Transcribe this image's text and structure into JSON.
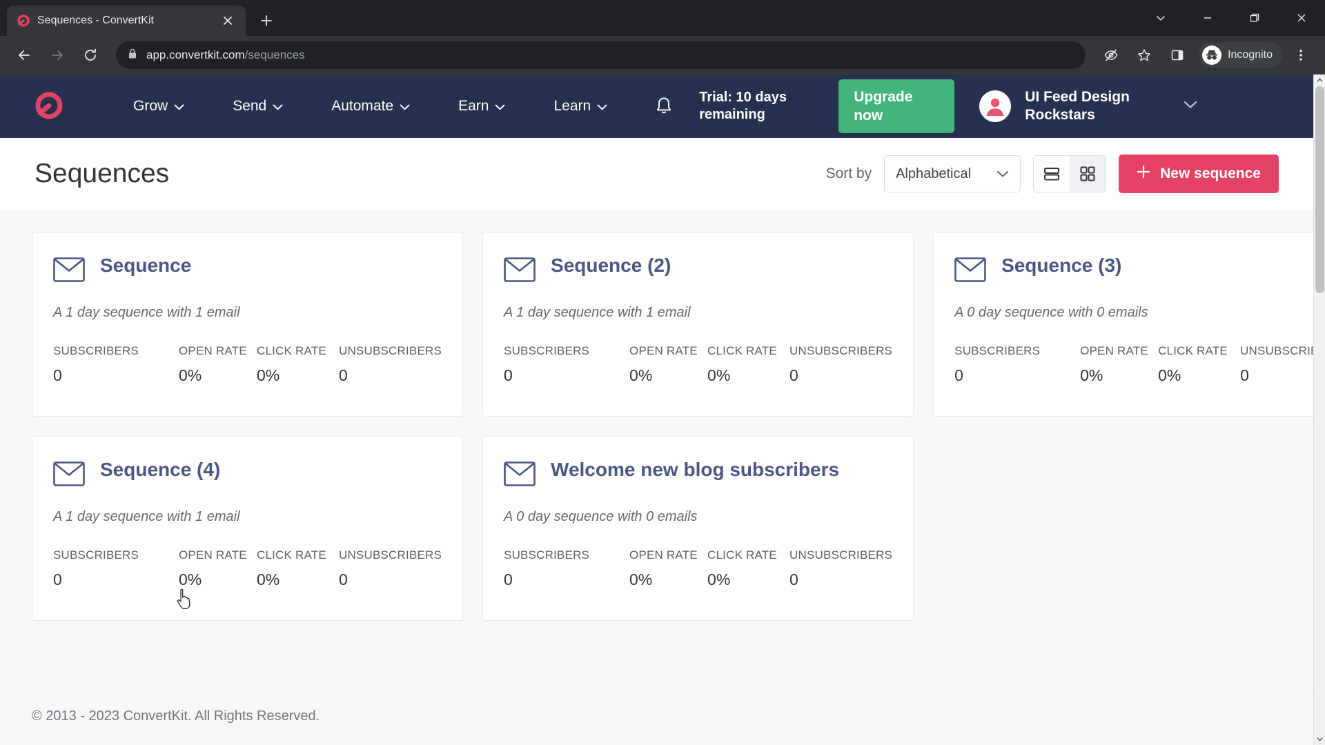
{
  "browser": {
    "tab": {
      "title": "Sequences - ConvertKit",
      "favicon_icon": "convertkit-logo-icon",
      "close_icon": "close-icon"
    },
    "new_tab_icon": "plus-icon",
    "window_controls": [
      {
        "name": "tab-search",
        "glyph": "⌄"
      },
      {
        "name": "minimize",
        "glyph": "—"
      },
      {
        "name": "maximize",
        "glyph": "❐"
      },
      {
        "name": "close",
        "glyph": "✕"
      }
    ],
    "nav": {
      "back_icon": "back-arrow-icon",
      "forward_icon": "forward-arrow-icon",
      "reload_icon": "reload-icon"
    },
    "omnibox": {
      "lock_icon": "lock-icon",
      "url_host": "app.convertkit.com",
      "url_path": "/sequences",
      "cookies_icon": "eye-slash-icon",
      "bookmark_icon": "star-icon",
      "side_panel_icon": "side-panel-icon"
    },
    "incognito": {
      "label": "Incognito",
      "icon": "incognito-icon"
    },
    "menu_icon": "kebab-menu-icon"
  },
  "appnav": {
    "logo_icon": "convertkit-logo-icon",
    "links": [
      {
        "label": "Grow",
        "icon": "chevron-down-icon"
      },
      {
        "label": "Send",
        "icon": "chevron-down-icon"
      },
      {
        "label": "Automate",
        "icon": "chevron-down-icon"
      },
      {
        "label": "Earn",
        "icon": "chevron-down-icon"
      },
      {
        "label": "Learn",
        "icon": "chevron-down-icon"
      }
    ],
    "notifications_icon": "bell-icon",
    "trial_text": "Trial: 10 days remaining",
    "upgrade_label": "Upgrade now",
    "account": {
      "avatar_icon": "user-avatar-icon",
      "name": "UI Feed Design Rockstars",
      "chevron_icon": "chevron-down-icon"
    }
  },
  "page": {
    "title": "Sequences",
    "sort": {
      "label": "Sort by",
      "value": "Alphabetical",
      "chevron_icon": "chevron-down-icon",
      "options": [
        "Alphabetical"
      ]
    },
    "view_toggle": {
      "list_icon": "list-view-icon",
      "grid_icon": "grid-view-icon",
      "active": "grid"
    },
    "new_sequence": {
      "label": "New sequence",
      "icon": "plus-icon"
    },
    "stat_labels": [
      "SUBSCRIBERS",
      "OPEN RATE",
      "CLICK RATE",
      "UNSUBSCRIBERS"
    ],
    "cards": [
      {
        "icon": "envelope-icon",
        "title": "Sequence",
        "subtitle": "A 1 day sequence with 1 email",
        "stats": [
          "0",
          "0%",
          "0%",
          "0"
        ]
      },
      {
        "icon": "envelope-icon",
        "title": "Sequence (2)",
        "subtitle": "A 1 day sequence with 1 email",
        "stats": [
          "0",
          "0%",
          "0%",
          "0"
        ]
      },
      {
        "icon": "envelope-icon",
        "title": "Sequence (3)",
        "subtitle": "A 0 day sequence with 0 emails",
        "stats": [
          "0",
          "0%",
          "0%",
          "0"
        ]
      },
      {
        "icon": "envelope-icon",
        "title": "Sequence (4)",
        "subtitle": "A 1 day sequence with 1 email",
        "stats": [
          "0",
          "0%",
          "0%",
          "0"
        ]
      },
      {
        "icon": "envelope-icon",
        "title": "Welcome new blog subscribers",
        "subtitle": "A 0 day sequence with 0 emails",
        "stats": [
          "0",
          "0%",
          "0%",
          "0"
        ]
      }
    ],
    "footer": "© 2013 - 2023 ConvertKit. All Rights Reserved."
  },
  "colors": {
    "nav_bg": "#26304f",
    "accent_pink": "#e34264",
    "accent_green": "#44b37c",
    "card_title": "#4a5684",
    "page_bg": "#f7f8f9"
  }
}
